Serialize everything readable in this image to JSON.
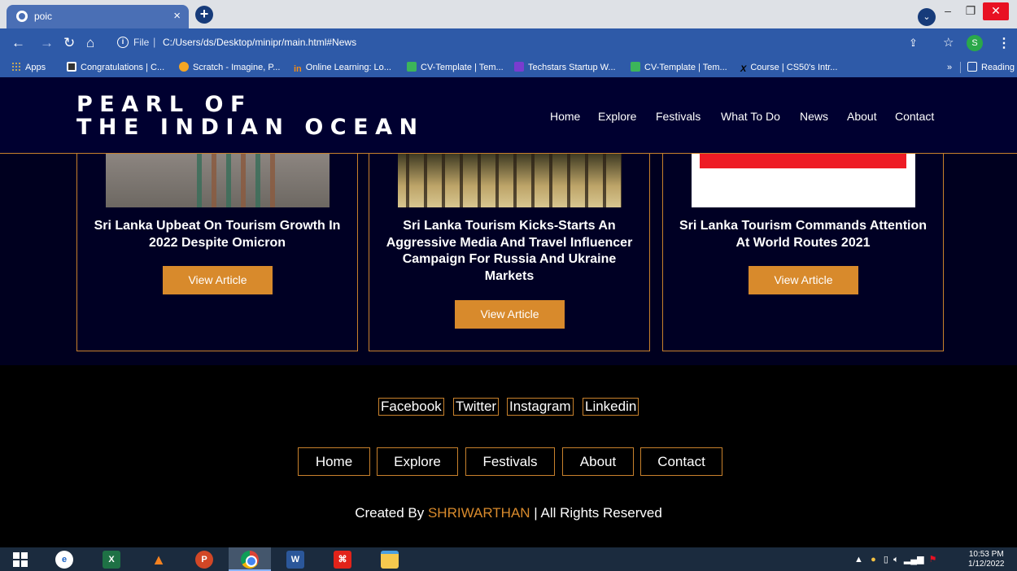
{
  "browser": {
    "tab_title": "poic",
    "tab_close": "×",
    "new_tab": "+",
    "tab_menu": "⌄",
    "file_label": "File",
    "separator": "|",
    "url": "C:/Users/ds/Desktop/minipr/main.html#News",
    "profile_initial": "S",
    "bookmarks": [
      {
        "label": "Apps"
      },
      {
        "label": "Congratulations | C..."
      },
      {
        "label": "Scratch - Imagine, P..."
      },
      {
        "icon_text": "in",
        "label": "Online Learning: Lo..."
      },
      {
        "label": "CV-Template | Tem..."
      },
      {
        "label": "Techstars Startup W..."
      },
      {
        "label": "CV-Template | Tem..."
      },
      {
        "icon_text": "X",
        "label": "Course | CS50's Intr..."
      }
    ],
    "bookmarks_more": "»",
    "reading_list": "Reading list"
  },
  "site": {
    "logo_line1": "PEARL OF",
    "logo_line2": "THE INDIAN OCEAN",
    "nav": [
      "Home",
      "Explore",
      "Festivals",
      "What To Do",
      "News",
      "About",
      "Contact"
    ]
  },
  "news": {
    "cards": [
      {
        "title": "Sri Lanka Upbeat On Tourism Growth In 2022 Despite Omicron",
        "button": "View Article"
      },
      {
        "title": "Sri Lanka Tourism Kicks-Starts An Aggressive Media And Travel Influencer Campaign For Russia And Ukraine Markets",
        "button": "View Article"
      },
      {
        "title": "Sri Lanka Tourism Commands Attention At World Routes 2021",
        "button": "View Article"
      }
    ]
  },
  "footer": {
    "social": [
      "Facebook",
      "Twitter",
      "Instagram",
      "Linkedin"
    ],
    "nav": [
      "Home",
      "Explore",
      "Festivals",
      "About",
      "Contact"
    ],
    "credits_prefix": "Created By ",
    "author": "SHRIWARTHAN",
    "credits_suffix": " | All Rights Reserved"
  },
  "taskbar": {
    "excel": "X",
    "ppt": "P",
    "word": "W",
    "time": "10:53 PM",
    "date": "1/12/2022"
  },
  "colors": {
    "accent": "#d88a2c",
    "page_bg": "#00001f",
    "header_bg": "#000030",
    "browser_blue": "#2e5aa8"
  }
}
